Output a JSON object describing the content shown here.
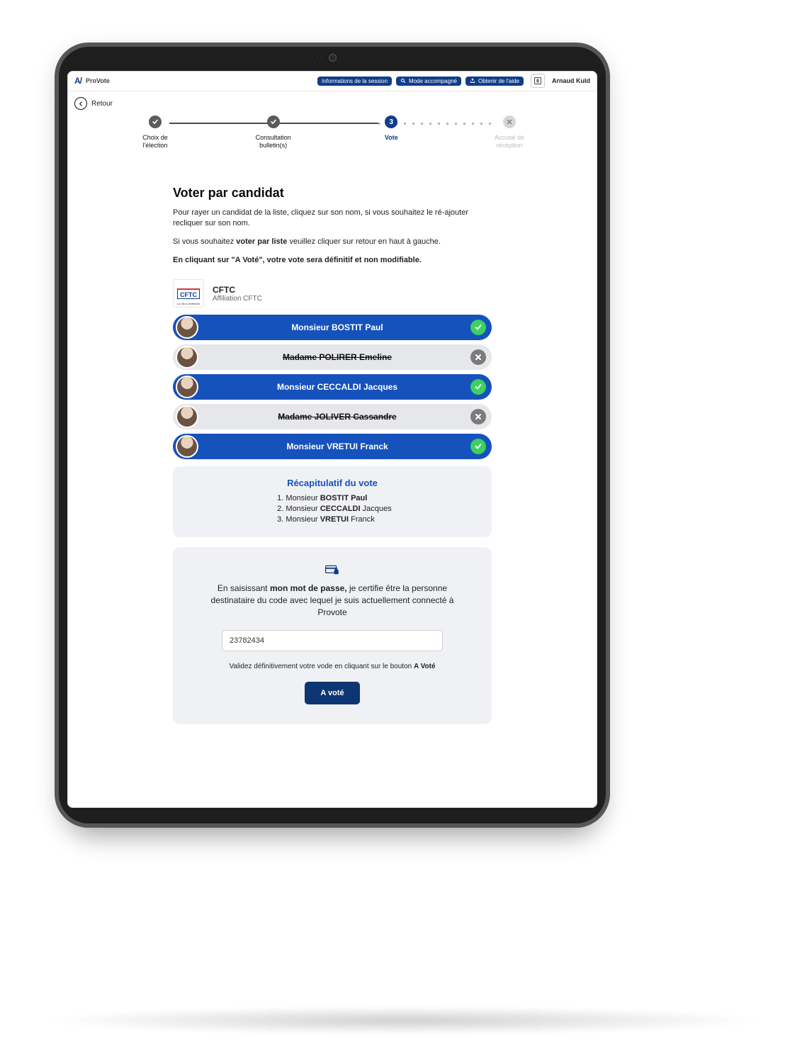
{
  "header": {
    "app_name": "ProVote",
    "pill_session": "Informations de la session",
    "pill_mode": "Mode accompagné",
    "pill_help": "Obtenir de l'aide",
    "user_name": "Arnaud Kuld"
  },
  "back_label": "Retour",
  "steps": {
    "s1": "Choix de l'élection",
    "s2": "Consultation bulletin(s)",
    "s3": "Vote",
    "s3_num": "3",
    "s4": "Accusé de réception"
  },
  "title": "Voter par candidat",
  "instructions": {
    "p1": "Pour rayer un candidat de la liste, cliquez sur son nom, si vous souhaitez le ré-ajouter recliquer sur son nom.",
    "p2_pre": "Si vous souhaitez ",
    "p2_bold": "voter par liste",
    "p2_post": " veuillez cliquer sur retour en haut à gauche.",
    "p3": "En cliquant sur \"A Voté\", votre vote sera définitif et non modifiable."
  },
  "list": {
    "code": "CFTC",
    "name": "CFTC",
    "sub": "Affiliation CFTC",
    "tagline": "La Vie à Défendre"
  },
  "candidates": [
    {
      "name": "Monsieur BOSTIT Paul",
      "selected": true
    },
    {
      "name": "Madame POLIRER Emeline",
      "selected": false
    },
    {
      "name": "Monsieur CECCALDI Jacques",
      "selected": true
    },
    {
      "name": "Madame JOLIVER Cassandre",
      "selected": false
    },
    {
      "name": "Monsieur VRETUI Franck",
      "selected": true
    }
  ],
  "recap": {
    "title": "Récapitulatif du vote",
    "items": [
      {
        "prefix": "Monsieur ",
        "strong": "BOSTIT Paul",
        "suffix": ""
      },
      {
        "prefix": "Monsieur ",
        "strong": "CECCALDI",
        "suffix": " Jacques"
      },
      {
        "prefix": "Monsieur ",
        "strong": "VRETUI",
        "suffix": " Franck"
      }
    ]
  },
  "password": {
    "lead_pre": "En saisissant ",
    "lead_bold": "mon mot de passe,",
    "lead_post": " je certifie être la personne destinataire du code avec lequel je suis actuellement connecté à Provote",
    "value": "23782434",
    "hint_pre": "Validez définitivement votre vode en cliquant sur le bouton ",
    "hint_bold": "A Voté",
    "cta": "A voté"
  }
}
